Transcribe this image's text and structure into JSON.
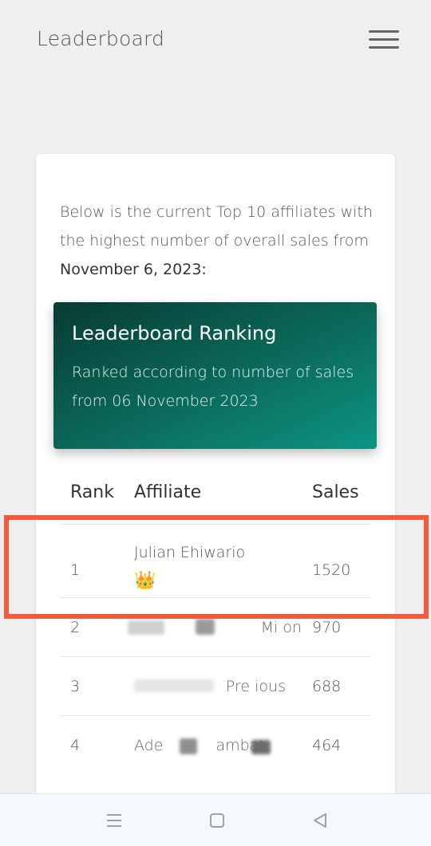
{
  "header": {
    "title": "Leaderboard",
    "menu_icon": "hamburger-menu-icon"
  },
  "intro": {
    "text": "Below is the current Top 10 affiliates with the highest number of overall sales from",
    "date": "November 6, 2023:"
  },
  "banner": {
    "title": "Leaderboard Ranking",
    "subtitle": "Ranked according to number of sales from 06 November 2023"
  },
  "table": {
    "columns": [
      "Rank",
      "Affiliate",
      "Sales"
    ],
    "rows": [
      {
        "rank": "1",
        "affiliate": "Julian Ehiwario",
        "sales": "1520",
        "badge": "crown-icon"
      },
      {
        "rank": "2",
        "affiliate": "Mi on",
        "sales": "970"
      },
      {
        "rank": "3",
        "affiliate": "Pre ious",
        "sales": "688"
      },
      {
        "rank": "4",
        "affiliate": "Ade ambat",
        "sales": "464"
      }
    ]
  },
  "colors": {
    "highlight": "#f45a3c",
    "banner_start": "#073b34",
    "banner_end": "#0d9483"
  },
  "nav": {
    "icons": [
      "recent-apps-icon",
      "home-icon",
      "back-icon"
    ]
  }
}
